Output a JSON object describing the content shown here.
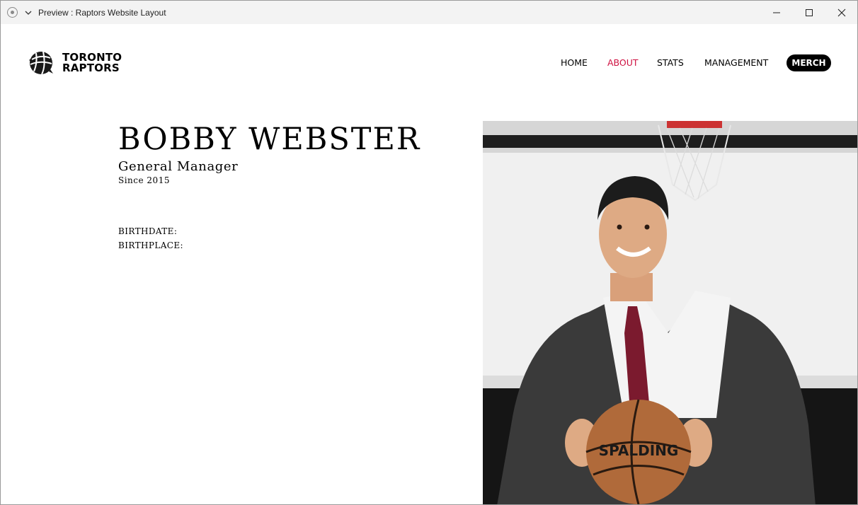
{
  "window": {
    "title": "Preview : Raptors Website Layout",
    "icons": [
      "record-icon",
      "chevron-down-icon",
      "minimize-icon",
      "maximize-icon",
      "close-icon"
    ]
  },
  "site": {
    "logo": {
      "line1": "TORONTO",
      "line2": "RAPTORS",
      "icon": "raptors-basketball-logo-icon"
    },
    "nav": [
      {
        "label": "HOME",
        "active": false
      },
      {
        "label": "ABOUT",
        "active": true
      },
      {
        "label": "STATS",
        "active": false
      },
      {
        "label": "MANAGEMENT",
        "active": false
      }
    ],
    "merch_label": "MERCH",
    "colors": {
      "accent": "#ce1141",
      "text": "#000000",
      "merch_bg": "#000000"
    }
  },
  "profile": {
    "name": "BOBBY WEBSTER",
    "role": "General Manager",
    "since": "Since 2015",
    "birthdate_label": "BIRTHDATE:",
    "birthplace_label": "BIRTHPLACE:",
    "photo_ball_text": "SPALDING"
  }
}
